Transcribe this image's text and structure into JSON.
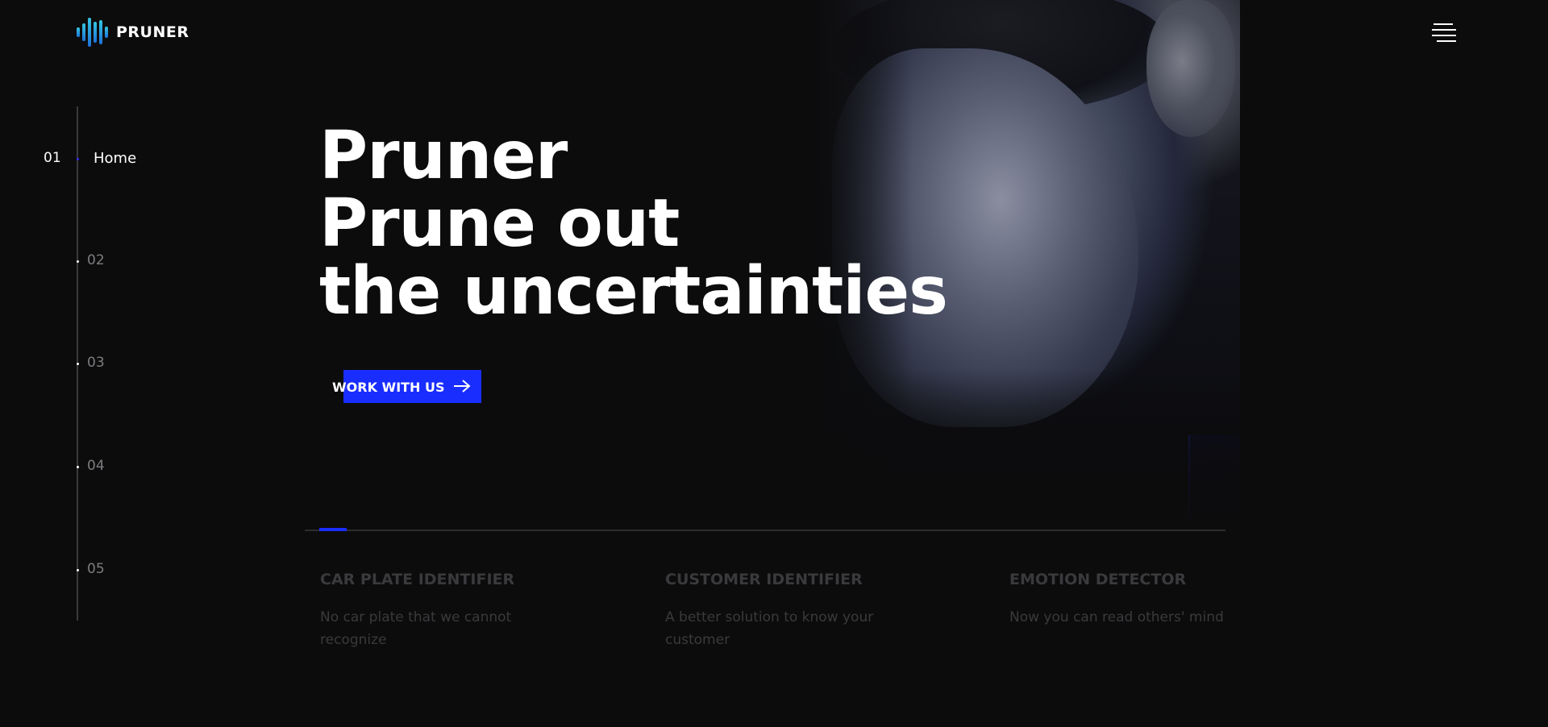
{
  "brand": {
    "name": "PRUNER",
    "logo_icon": "soundwave-logo-icon",
    "accent_color": "#1a2dff",
    "logo_colors": [
      "#36c6e0",
      "#1d72d8"
    ]
  },
  "header": {
    "menu_icon": "hamburger-menu-icon"
  },
  "side_nav": {
    "items": [
      {
        "number": "01",
        "label": "Home",
        "active": true
      },
      {
        "number": "02",
        "active": false
      },
      {
        "number": "03",
        "active": false
      },
      {
        "number": "04",
        "active": false
      },
      {
        "number": "05",
        "active": false
      }
    ]
  },
  "hero": {
    "title_lines": [
      "Pruner",
      "Prune out",
      "the uncertainties"
    ],
    "cta_label": "WORK WITH US",
    "cta_icon": "arrow-right-icon",
    "image": "man-profile-portrait"
  },
  "slider": {
    "progress": 0.03
  },
  "features": [
    {
      "title": "CAR PLATE IDENTIFIER",
      "description": "No car plate that we cannot recognize"
    },
    {
      "title": "CUSTOMER IDENTIFIER",
      "description": "A better solution to know your customer"
    },
    {
      "title": "EMOTION DETECTOR",
      "description": "Now you can read others' mind"
    }
  ]
}
